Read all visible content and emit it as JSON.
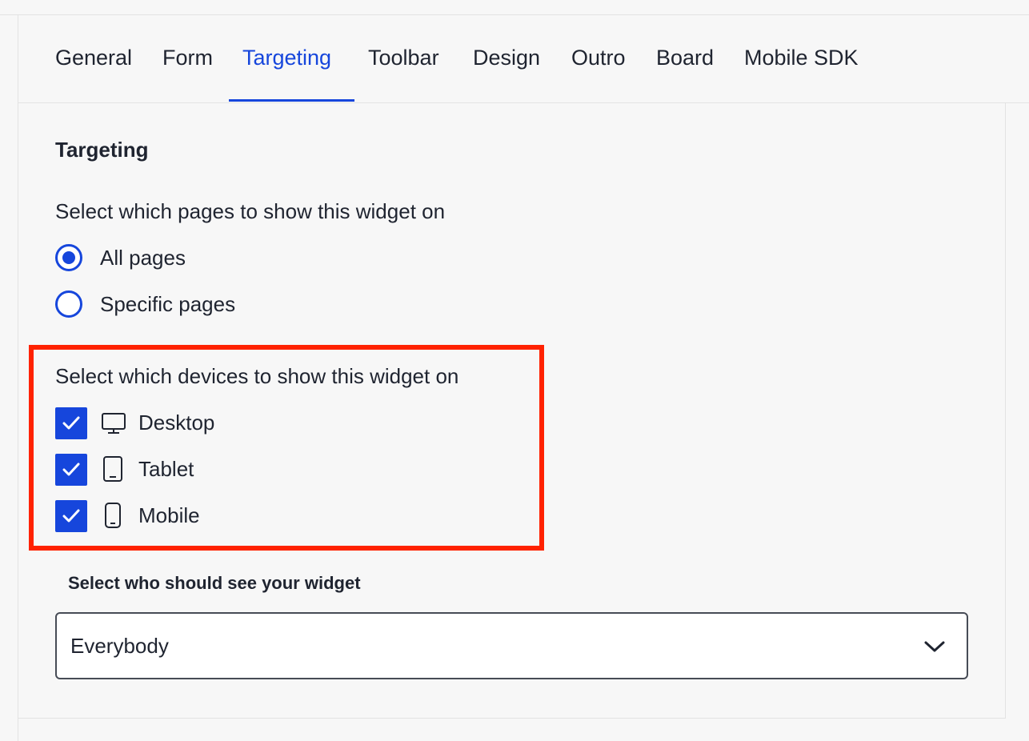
{
  "tabs": [
    {
      "label": "General",
      "active": false
    },
    {
      "label": "Form",
      "active": false
    },
    {
      "label": "Targeting",
      "active": true
    },
    {
      "label": "Toolbar",
      "active": false
    },
    {
      "label": "Design",
      "active": false
    },
    {
      "label": "Outro",
      "active": false
    },
    {
      "label": "Board",
      "active": false
    },
    {
      "label": "Mobile SDK",
      "active": false
    }
  ],
  "section": {
    "title": "Targeting"
  },
  "pages": {
    "label": "Select which pages to show this widget on",
    "options": [
      {
        "label": "All pages",
        "selected": true
      },
      {
        "label": "Specific pages",
        "selected": false
      }
    ]
  },
  "devices": {
    "label": "Select which devices to show this widget on",
    "options": [
      {
        "label": "Desktop",
        "icon": "desktop-icon",
        "checked": true
      },
      {
        "label": "Tablet",
        "icon": "tablet-icon",
        "checked": true
      },
      {
        "label": "Mobile",
        "icon": "mobile-icon",
        "checked": true
      }
    ]
  },
  "audience": {
    "label": "Select who should see your widget",
    "value": "Everybody"
  },
  "colors": {
    "accent": "#1646dc",
    "highlight": "#ff2200",
    "text": "#1f2430",
    "background": "#f7f7f7"
  }
}
